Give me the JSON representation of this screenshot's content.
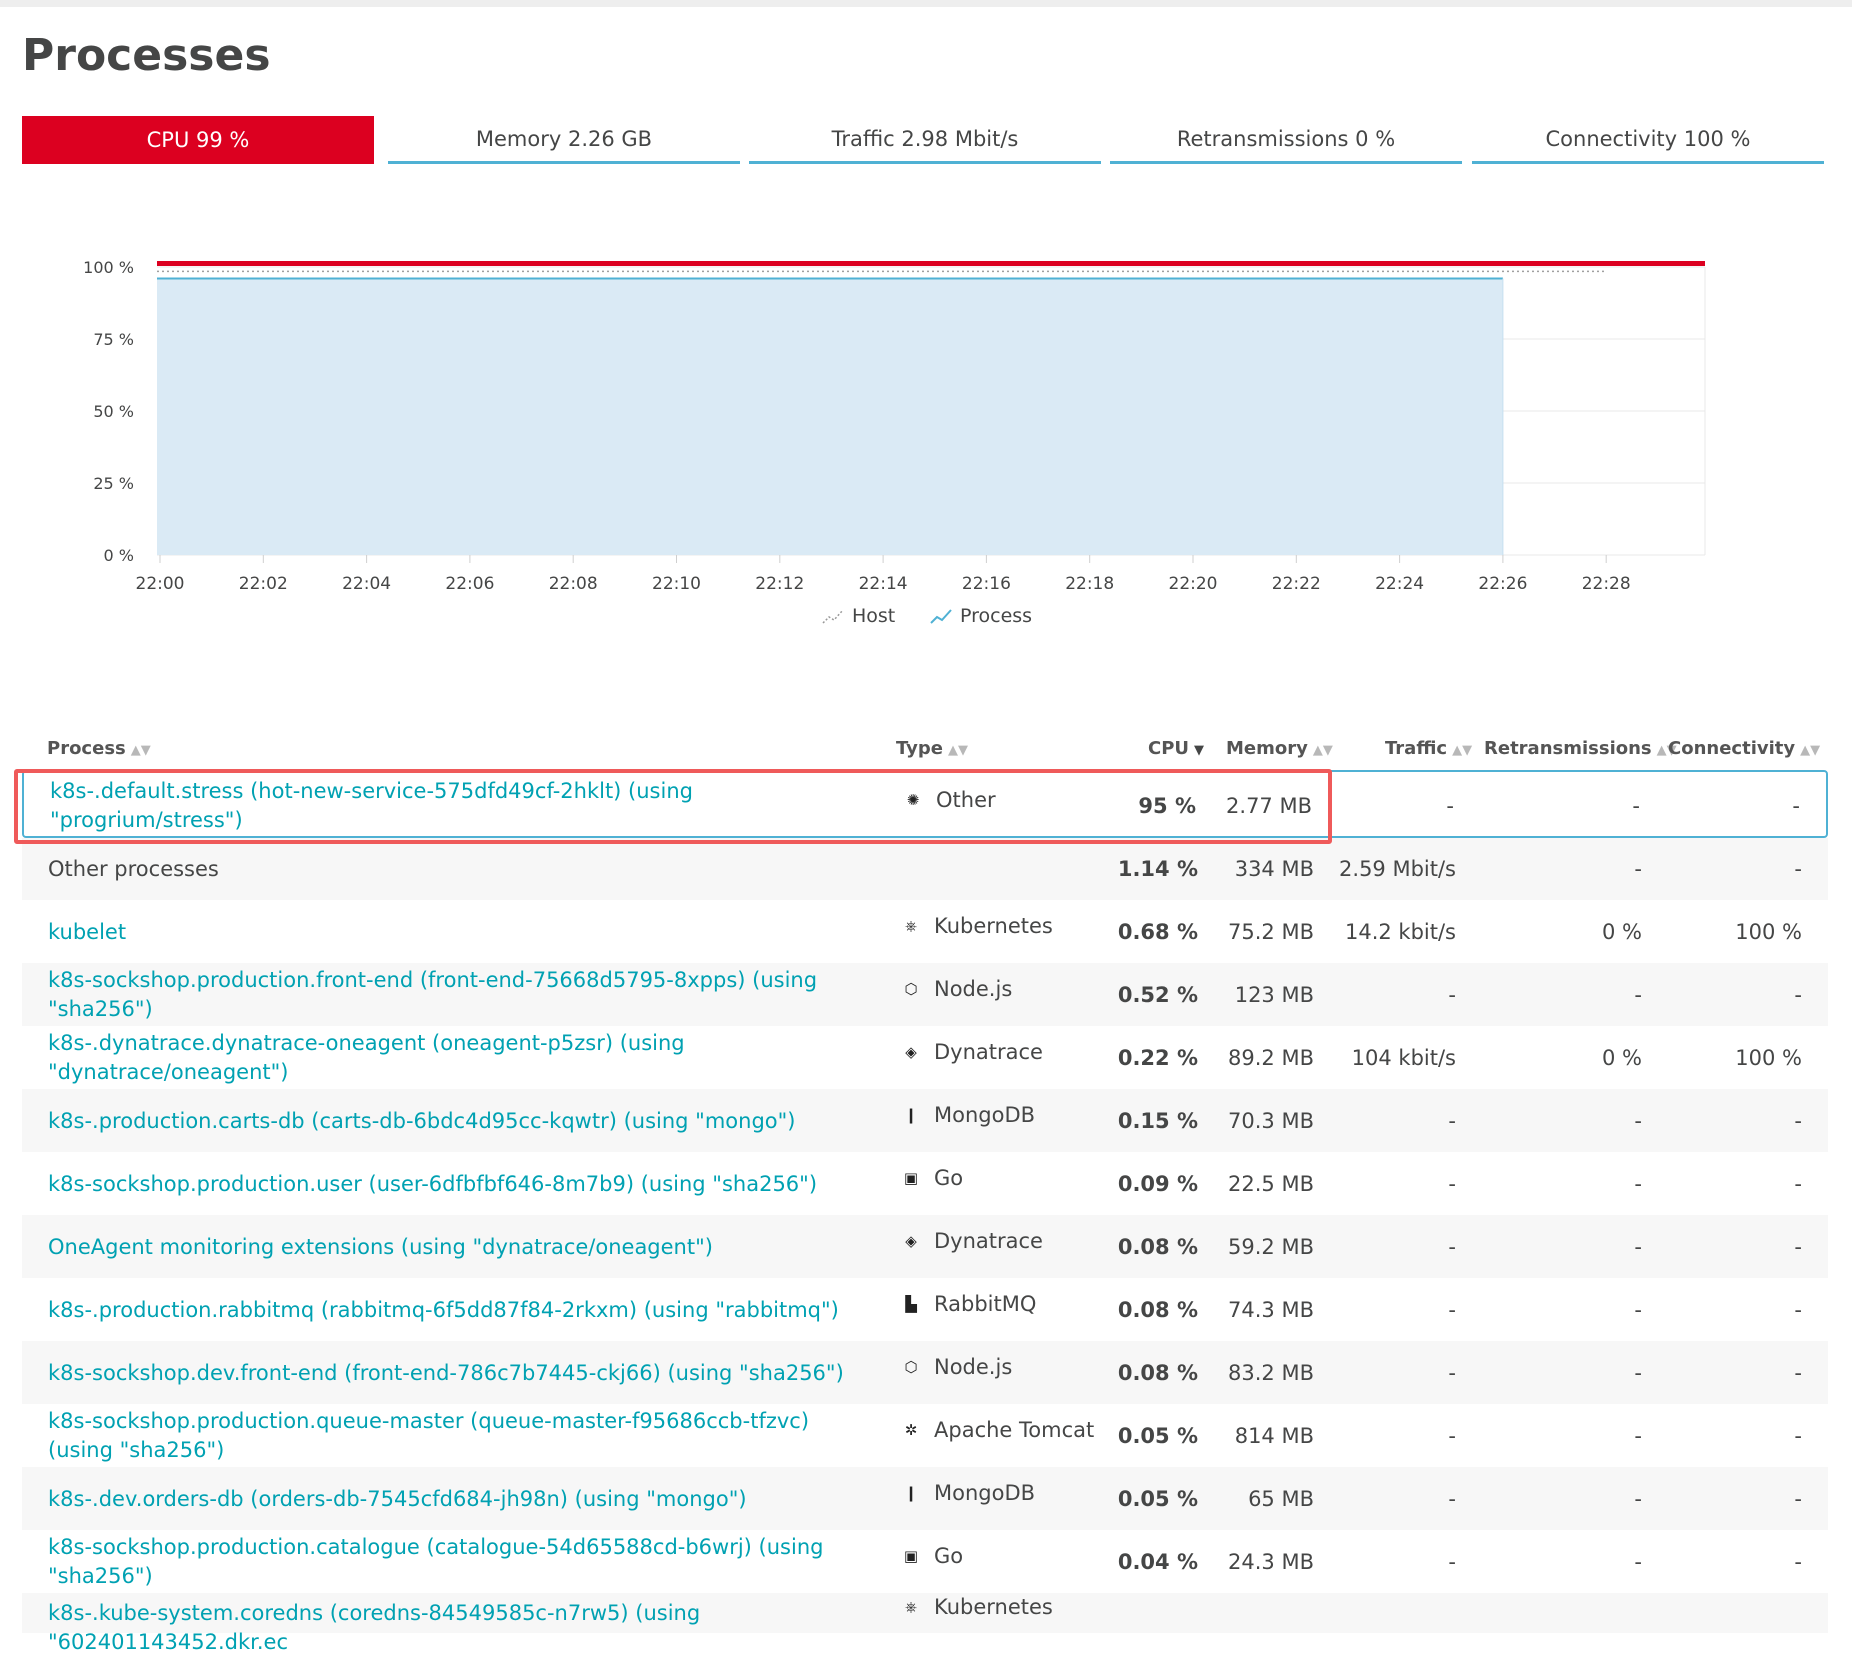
{
  "page": {
    "title": "Processes"
  },
  "tabs": [
    {
      "label": "CPU 99 %"
    },
    {
      "label": "Memory 2.26 GB"
    },
    {
      "label": "Traffic 2.98 Mbit/s"
    },
    {
      "label": "Retransmissions 0 %"
    },
    {
      "label": "Connectivity 100 %"
    }
  ],
  "colors": {
    "accent": "#dc0020",
    "link": "#00a1b2",
    "tab_underline": "#4fb1d4",
    "area_fill": "#daeaf5",
    "area_line": "#4fb1d4",
    "highlight": "#ef5a5a"
  },
  "chart_data": {
    "type": "area",
    "x": [
      "22:00",
      "22:02",
      "22:04",
      "22:06",
      "22:08",
      "22:10",
      "22:12",
      "22:14",
      "22:16",
      "22:18",
      "22:20",
      "22:22",
      "22:24",
      "22:26",
      "22:28"
    ],
    "ylim": [
      0,
      100
    ],
    "yticks": [
      "0 %",
      "25 %",
      "50 %",
      "75 %",
      "100 %"
    ],
    "grid": true,
    "legend_position": "bottom-center",
    "threshold": 100,
    "series": [
      {
        "name": "Host",
        "values": [
          98.5,
          98.5,
          98.5,
          98.5,
          98.5,
          98.5,
          98.5,
          98.5,
          98.5,
          98.5,
          98.5,
          98.5,
          98.5,
          98.5,
          98.5
        ]
      },
      {
        "name": "Process",
        "values": [
          96,
          96,
          96,
          96,
          96,
          96,
          96,
          96,
          96,
          96,
          96,
          96,
          96,
          96
        ]
      }
    ]
  },
  "table": {
    "headers": {
      "process": "Process",
      "type": "Type",
      "cpu": "CPU",
      "memory": "Memory",
      "traffic": "Traffic",
      "retransmissions": "Retransmissions",
      "connectivity": "Connectivity"
    },
    "rows": [
      {
        "name": "k8s-.default.stress (hot-new-service-575dfd49cf-2hklt) (using \"progrium/stress\")",
        "type": "Other",
        "icon": "other-icon",
        "cpu": "95 %",
        "mem": "2.77 MB",
        "traffic": "-",
        "retr": "-",
        "conn": "-"
      },
      {
        "name": "Other processes",
        "type": "",
        "icon": "",
        "cpu": "1.14 %",
        "mem": "334 MB",
        "traffic": "2.59 Mbit/s",
        "retr": "-",
        "conn": "-"
      },
      {
        "name": "kubelet",
        "type": "Kubernetes",
        "icon": "kubernetes-icon",
        "cpu": "0.68 %",
        "mem": "75.2 MB",
        "traffic": "14.2 kbit/s",
        "retr": "0 %",
        "conn": "100 %"
      },
      {
        "name": "k8s-sockshop.production.front-end (front-end-75668d5795-8xpps) (using \"sha256\")",
        "type": "Node.js",
        "icon": "nodejs-icon",
        "cpu": "0.52 %",
        "mem": "123 MB",
        "traffic": "-",
        "retr": "-",
        "conn": "-"
      },
      {
        "name": "k8s-.dynatrace.dynatrace-oneagent (oneagent-p5zsr) (using \"dynatrace/oneagent\")",
        "type": "Dynatrace",
        "icon": "dynatrace-icon",
        "cpu": "0.22 %",
        "mem": "89.2 MB",
        "traffic": "104 kbit/s",
        "retr": "0 %",
        "conn": "100 %"
      },
      {
        "name": "k8s-.production.carts-db (carts-db-6bdc4d95cc-kqwtr) (using \"mongo\")",
        "type": "MongoDB",
        "icon": "mongodb-icon",
        "cpu": "0.15 %",
        "mem": "70.3 MB",
        "traffic": "-",
        "retr": "-",
        "conn": "-"
      },
      {
        "name": "k8s-sockshop.production.user (user-6dfbfbf646-8m7b9) (using \"sha256\")",
        "type": "Go",
        "icon": "go-icon",
        "cpu": "0.09 %",
        "mem": "22.5 MB",
        "traffic": "-",
        "retr": "-",
        "conn": "-"
      },
      {
        "name": "OneAgent monitoring extensions (using \"dynatrace/oneagent\")",
        "type": "Dynatrace",
        "icon": "dynatrace-icon",
        "cpu": "0.08 %",
        "mem": "59.2 MB",
        "traffic": "-",
        "retr": "-",
        "conn": "-"
      },
      {
        "name": "k8s-.production.rabbitmq (rabbitmq-6f5dd87f84-2rkxm) (using \"rabbitmq\")",
        "type": "RabbitMQ",
        "icon": "rabbitmq-icon",
        "cpu": "0.08 %",
        "mem": "74.3 MB",
        "traffic": "-",
        "retr": "-",
        "conn": "-"
      },
      {
        "name": "k8s-sockshop.dev.front-end (front-end-786c7b7445-ckj66) (using \"sha256\")",
        "type": "Node.js",
        "icon": "nodejs-icon",
        "cpu": "0.08 %",
        "mem": "83.2 MB",
        "traffic": "-",
        "retr": "-",
        "conn": "-"
      },
      {
        "name": "k8s-sockshop.production.queue-master (queue-master-f95686ccb-tfzvc) (using \"sha256\")",
        "type": "Apache Tomcat",
        "icon": "tomcat-icon",
        "cpu": "0.05 %",
        "mem": "814 MB",
        "traffic": "-",
        "retr": "-",
        "conn": "-"
      },
      {
        "name": "k8s-.dev.orders-db (orders-db-7545cfd684-jh98n) (using \"mongo\")",
        "type": "MongoDB",
        "icon": "mongodb-icon",
        "cpu": "0.05 %",
        "mem": "65 MB",
        "traffic": "-",
        "retr": "-",
        "conn": "-"
      },
      {
        "name": "k8s-sockshop.production.catalogue (catalogue-54d65588cd-b6wrj) (using \"sha256\")",
        "type": "Go",
        "icon": "go-icon",
        "cpu": "0.04 %",
        "mem": "24.3 MB",
        "traffic": "-",
        "retr": "-",
        "conn": "-"
      },
      {
        "name": "k8s-.kube-system.coredns (coredns-84549585c-n7rw5) (using \"602401143452.dkr.ec",
        "type": "Kubernetes",
        "icon": "kubernetes-icon",
        "cpu": "",
        "mem": "",
        "traffic": "",
        "retr": "",
        "conn": ""
      }
    ]
  }
}
